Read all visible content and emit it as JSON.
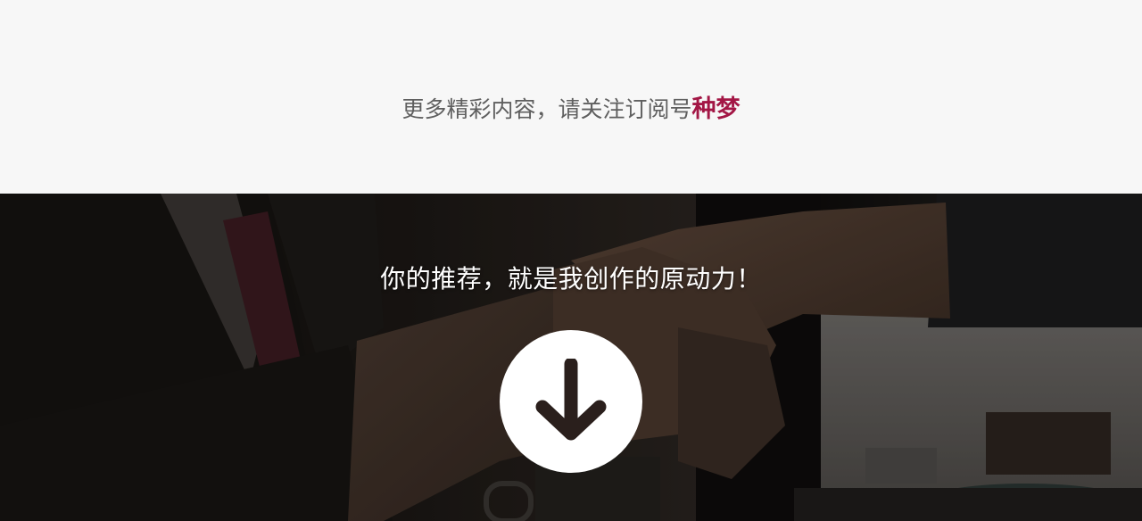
{
  "header": {
    "subscribe_prefix": "更多精彩内容，请关注订阅号",
    "account_name": "种梦",
    "account_color": "#a31645"
  },
  "hero": {
    "slogan": "你的推荐，就是我创作的原动力！",
    "background_image": "handshake-photo",
    "action_icon": "arrow-down-icon"
  }
}
